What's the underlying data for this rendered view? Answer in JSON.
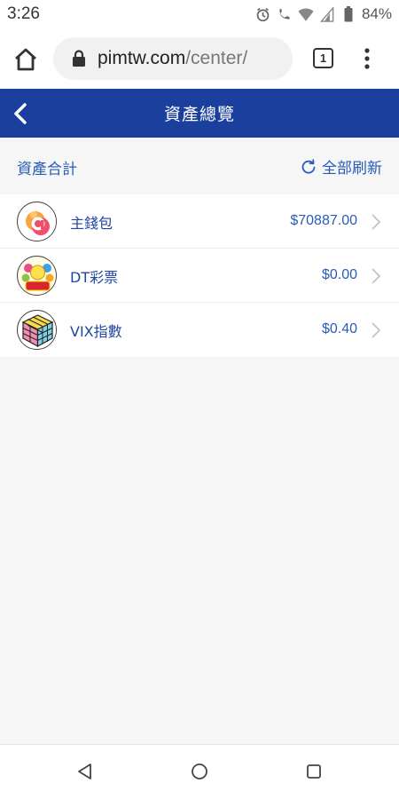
{
  "status_bar": {
    "time": "3:26",
    "battery": "84%",
    "icons": [
      "alarm-icon",
      "wifi-call-icon",
      "wifi-icon",
      "signal-icon",
      "battery-icon"
    ]
  },
  "browser": {
    "url_host": "pimtw.com",
    "url_path": "/center/",
    "tab_count": "1"
  },
  "header": {
    "title": "資產總覽"
  },
  "summary": {
    "label": "資產合計",
    "refresh_label": "全部刷新"
  },
  "assets": [
    {
      "name": "主錢包",
      "amount": "$70887.00",
      "icon": "main-wallet-logo"
    },
    {
      "name": "DT彩票",
      "amount": "$0.00",
      "icon": "bingo-lottery-logo"
    },
    {
      "name": "VIX指數",
      "amount": "$0.40",
      "icon": "rubik-cube-logo"
    }
  ],
  "colors": {
    "header_bg": "#1a3f9c",
    "accent_blue": "#2a5bb8",
    "page_bg": "#f6f6f6"
  }
}
